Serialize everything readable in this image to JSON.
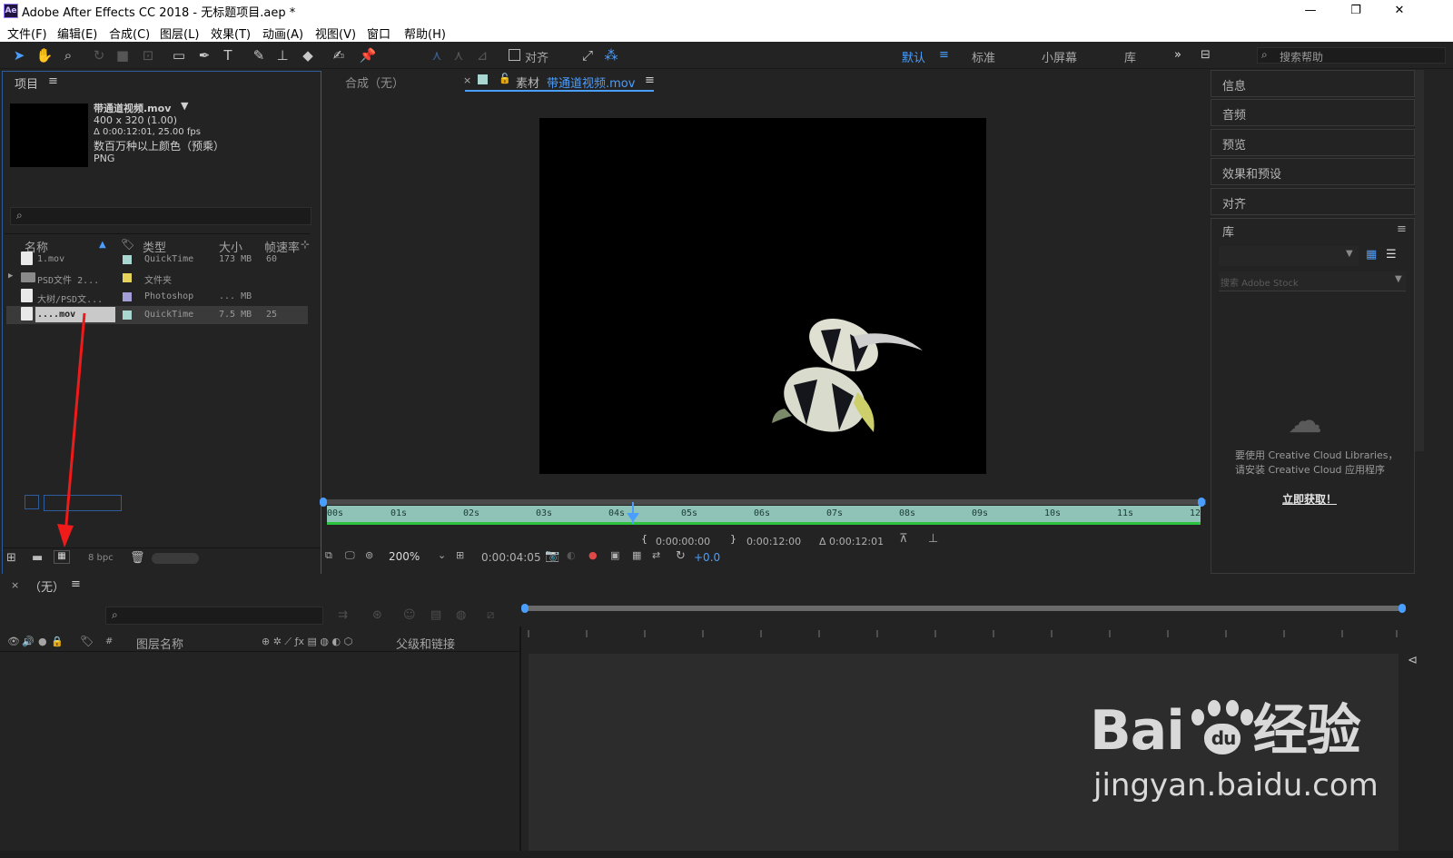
{
  "window": {
    "title": "Adobe After Effects CC 2018 - 无标题项目.aep *",
    "app_icon": "Ae",
    "controls": [
      "minimize-icon",
      "restore-icon",
      "close-icon"
    ]
  },
  "menu": [
    "文件(F)",
    "编辑(E)",
    "合成(C)",
    "图层(L)",
    "效果(T)",
    "动画(A)",
    "视图(V)",
    "窗口",
    "帮助(H)"
  ],
  "toolbar": {
    "snap_label": "对齐",
    "workspaces": [
      "默认",
      "标准",
      "小屏幕",
      "库"
    ],
    "search_help_placeholder": "搜索帮助"
  },
  "project": {
    "title": "项目",
    "selected": {
      "name": "带通道视频.mov",
      "dims": "400 x 320 (1.00)",
      "duration": "Δ 0:00:12:01, 25.00 fps",
      "colors": "数百万种以上颜色（预乘）",
      "codec": "PNG"
    },
    "columns": [
      "名称",
      "类型",
      "大小",
      "帧速率"
    ],
    "rows": [
      {
        "name": "1.mov",
        "type": "QuickTime",
        "size": "173 MB",
        "fps": "60",
        "swatch": "#a9d6d0"
      },
      {
        "name": "PSD文件 2...",
        "type": "文件夹",
        "size": "",
        "fps": "",
        "swatch": "#e6d35b"
      },
      {
        "name": "大树/PSD文...",
        "type": "Photoshop",
        "size": "... MB",
        "fps": "",
        "swatch": "#a49ed6"
      },
      {
        "name": "....mov",
        "type": "QuickTime",
        "size": "7.5 MB",
        "fps": "25",
        "swatch": "#a9d6d0"
      }
    ],
    "bpc": "8 bpc"
  },
  "viewer": {
    "comp_tab": "合成（无）",
    "footage_prefix": "素材",
    "footage_name": "带通道视频.mov",
    "ruler_ticks": [
      "00s",
      "01s",
      "02s",
      "03s",
      "04s",
      "05s",
      "06s",
      "07s",
      "08s",
      "09s",
      "10s",
      "11s",
      "12"
    ],
    "in_point": "0:00:00:00",
    "out_point": "0:00:12:00",
    "duration": "Δ 0:00:12:01",
    "zoom": "200%",
    "current_time": "0:00:04:05",
    "exposure": "+0.0"
  },
  "right_panels": [
    "信息",
    "音频",
    "预览",
    "效果和预设",
    "对齐",
    "库"
  ],
  "library": {
    "search_placeholder": "搜索 Adobe Stock",
    "message_line1": "要使用 Creative Cloud Libraries，",
    "message_line2": "请安装 Creative Cloud 应用程序",
    "link": "立即获取！"
  },
  "timeline": {
    "tab": "（无）",
    "columns": [
      "#",
      "图层名称",
      "父级和链接"
    ]
  },
  "watermark": {
    "brand": "Bai",
    "brand_cn": "经验",
    "url": "jingyan.baidu.com"
  }
}
